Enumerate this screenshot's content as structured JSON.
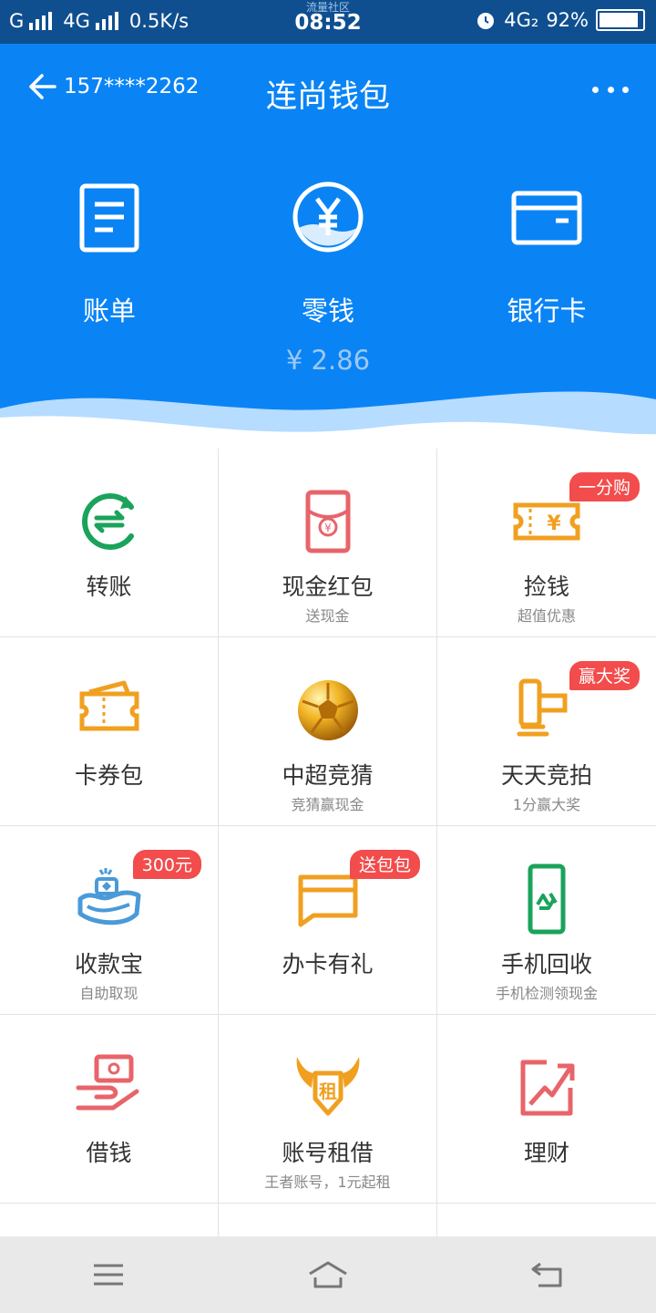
{
  "status_bar": {
    "signal_1": "G",
    "signal_2": "4G",
    "speed": "0.5K/s",
    "carrier": "流量社区",
    "time": "08:52",
    "network": "4G₂",
    "battery": "92%",
    "battery_level": 0.92
  },
  "header": {
    "phone": "157****2262",
    "title": "连尚钱包",
    "items": [
      {
        "label": "账单",
        "icon": "bill-icon"
      },
      {
        "label": "零钱",
        "icon": "yuan-coin-icon",
        "value": "¥ 2.86"
      },
      {
        "label": "银行卡",
        "icon": "bank-card-icon"
      }
    ]
  },
  "grid": [
    {
      "label": "转账",
      "sub": "",
      "badge": "",
      "icon": "transfer-icon"
    },
    {
      "label": "现金红包",
      "sub": "送现金",
      "badge": "",
      "icon": "red-packet-icon"
    },
    {
      "label": "捡钱",
      "sub": "超值优惠",
      "badge": "一分购",
      "icon": "ticket-yuan-icon"
    },
    {
      "label": "卡券包",
      "sub": "",
      "badge": "",
      "icon": "coupon-icon"
    },
    {
      "label": "中超竞猜",
      "sub": "竞猜赢现金",
      "badge": "",
      "icon": "soccer-ball-icon"
    },
    {
      "label": "天天竞拍",
      "sub": "1分赢大奖",
      "badge": "赢大奖",
      "icon": "auction-hammer-icon"
    },
    {
      "label": "收款宝",
      "sub": "自助取现",
      "badge": "300元",
      "icon": "coin-hand-icon"
    },
    {
      "label": "办卡有礼",
      "sub": "",
      "badge": "送包包",
      "icon": "card-message-icon"
    },
    {
      "label": "手机回收",
      "sub": "手机检测领现金",
      "badge": "",
      "icon": "phone-recycle-icon"
    },
    {
      "label": "借钱",
      "sub": "",
      "badge": "",
      "icon": "borrow-hand-icon"
    },
    {
      "label": "账号租借",
      "sub": "王者账号，1元起租",
      "badge": "",
      "icon": "rent-wings-icon"
    },
    {
      "label": "理财",
      "sub": "",
      "badge": "",
      "icon": "trend-chart-icon"
    }
  ],
  "colors": {
    "header_blue": "#0a84f5",
    "status_bar": "#0f4f90",
    "badge_red": "#f24c4c",
    "green": "#1aa35b",
    "orange": "#f0a020",
    "pink": "#e8646a"
  }
}
